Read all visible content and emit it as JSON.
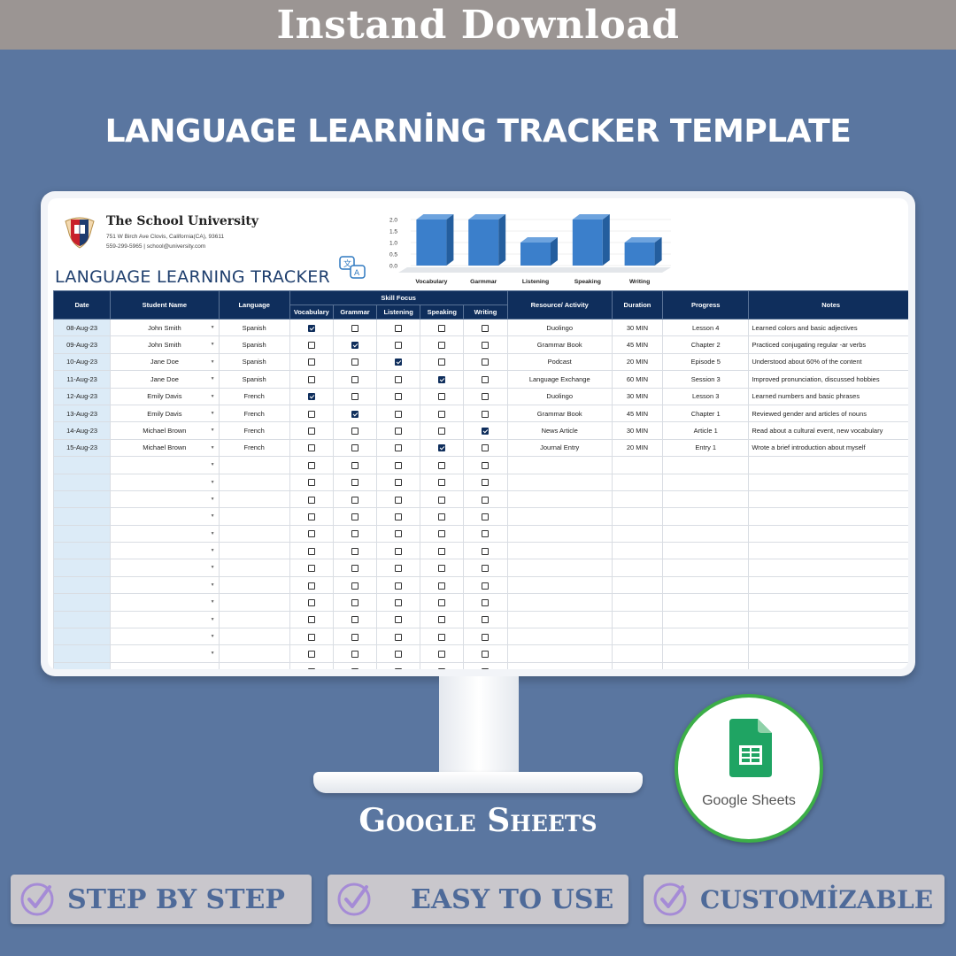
{
  "banner": {
    "text": "Instand Download"
  },
  "title": "LANGUAGE LEARNİNG TRACKER TEMPLATE",
  "sheet": {
    "school_name": "The School University",
    "address": "751 W Birch Ave Clovis, California(CA), 93611",
    "contact": "559-299-5965 | school@university.com",
    "tracker_title": "LANGUAGE LEARNING TRACKER",
    "headers": {
      "date": "Date",
      "student": "Student Name",
      "language": "Language",
      "skill_focus": "Skill Focus",
      "skills": [
        "Vocabulary",
        "Grammar",
        "Listening",
        "Speaking",
        "Writing"
      ],
      "resource": "Resource/ Activity",
      "duration": "Duration",
      "progress": "Progress",
      "notes": "Notes"
    },
    "rows": [
      {
        "date": "08-Aug-23",
        "student": "John Smith",
        "language": "Spanish",
        "skill": 0,
        "resource": "Duolingo",
        "duration": "30 MIN",
        "progress": "Lesson 4",
        "notes": "Learned colors and basic adjectives"
      },
      {
        "date": "09-Aug-23",
        "student": "John Smith",
        "language": "Spanish",
        "skill": 1,
        "resource": "Grammar Book",
        "duration": "45 MIN",
        "progress": "Chapter 2",
        "notes": "Practiced conjugating regular -ar verbs"
      },
      {
        "date": "10-Aug-23",
        "student": "Jane Doe",
        "language": "Spanish",
        "skill": 2,
        "resource": "Podcast",
        "duration": "20 MIN",
        "progress": "Episode 5",
        "notes": "Understood about 60% of the content"
      },
      {
        "date": "11-Aug-23",
        "student": "Jane Doe",
        "language": "Spanish",
        "skill": 3,
        "resource": "Language Exchange",
        "duration": "60 MIN",
        "progress": "Session 3",
        "notes": "Improved pronunciation, discussed hobbies"
      },
      {
        "date": "12-Aug-23",
        "student": "Emily Davis",
        "language": "French",
        "skill": 0,
        "resource": "Duolingo",
        "duration": "30 MIN",
        "progress": "Lesson 3",
        "notes": "Learned numbers and basic phrases"
      },
      {
        "date": "13-Aug-23",
        "student": "Emily Davis",
        "language": "French",
        "skill": 1,
        "resource": "Grammar Book",
        "duration": "45 MIN",
        "progress": "Chapter 1",
        "notes": "Reviewed gender and articles of nouns"
      },
      {
        "date": "14-Aug-23",
        "student": "Michael Brown",
        "language": "French",
        "skill": 4,
        "resource": "News Article",
        "duration": "30 MIN",
        "progress": "Article 1",
        "notes": "Read about a cultural event, new vocabulary"
      },
      {
        "date": "15-Aug-23",
        "student": "Michael Brown",
        "language": "French",
        "skill": 3,
        "resource": "Journal Entry",
        "duration": "20 MIN",
        "progress": "Entry 1",
        "notes": "Wrote a brief introduction about myself"
      }
    ],
    "empty_rows": 13
  },
  "chart_data": {
    "type": "bar",
    "categories": [
      "Vocabulary",
      "Garmmar",
      "Listening",
      "Speaking",
      "Writing"
    ],
    "values": [
      2,
      2,
      1,
      2,
      1
    ],
    "yticks": [
      "2.0",
      "1.5",
      "1.0",
      "0.5",
      "0.0"
    ],
    "ylim": [
      0,
      2
    ],
    "bar_color": "#3b7fcb"
  },
  "caption": "Google Sheets",
  "badge": {
    "label": "Google Sheets"
  },
  "features": [
    "STEP BY STEP",
    "EASY TO USE",
    "CUSTOMİZABLE"
  ],
  "colors": {
    "background": "#5a76a0",
    "header": "#0f2e5c",
    "accent_green": "#3cae48"
  }
}
